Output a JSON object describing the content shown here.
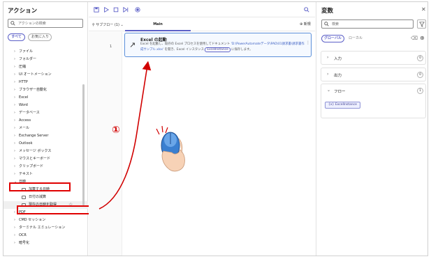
{
  "actions_panel": {
    "title": "アクション",
    "search_placeholder": "アクションの検索",
    "chip_all": "すべて",
    "chip_favorites": "お気に入り",
    "tree": [
      {
        "label": "ファイル",
        "expanded": false
      },
      {
        "label": "フォルダー",
        "expanded": false
      },
      {
        "label": "圧縮",
        "expanded": false
      },
      {
        "label": "UI オートメーション",
        "expanded": false
      },
      {
        "label": "HTTP",
        "expanded": false
      },
      {
        "label": "ブラウザー自動化",
        "expanded": false
      },
      {
        "label": "Excel",
        "expanded": false
      },
      {
        "label": "Word",
        "expanded": false
      },
      {
        "label": "データベース",
        "expanded": false
      },
      {
        "label": "Access",
        "expanded": false
      },
      {
        "label": "メール",
        "expanded": false
      },
      {
        "label": "Exchange Server",
        "expanded": false
      },
      {
        "label": "Outlook",
        "expanded": false
      },
      {
        "label": "メッセージ ボックス",
        "expanded": false
      },
      {
        "label": "マウスとキーボード",
        "expanded": false
      },
      {
        "label": "クリップボード",
        "expanded": false
      },
      {
        "label": "テキスト",
        "expanded": false
      },
      {
        "label": "日時",
        "expanded": true
      }
    ],
    "datetime_children": [
      "加算する日時",
      "日付の減算",
      "現在の日時を取得"
    ],
    "tree_after": [
      "PDF",
      "CMD セッション",
      "ターミナル エミュレーション",
      "OCR",
      "暗号化"
    ]
  },
  "designer": {
    "subflow_label": "サブフロー (1)",
    "tab_main": "Main",
    "new_label": "新規",
    "line_number": "1",
    "step": {
      "title": "Excel の起動",
      "desc_prefix": "Excel を起動し、既存の Excel プロセスを使用してドキュメント",
      "desc_path": "'D:\\PowerAutomateデータ\\PAD\\01請求書\\請求書作成サンプル.xlsx'",
      "desc_mid": "を開き、Excel インスタンス",
      "desc_var": "ExcelInstance",
      "desc_suffix": "に保存します。"
    },
    "annotation_number": "①"
  },
  "variables_panel": {
    "title": "変数",
    "search_placeholder": "検索",
    "chip_global": "グローバル",
    "chip_local": "ローカル",
    "sections": [
      {
        "label": "入力",
        "count": "0"
      },
      {
        "label": "出力",
        "count": "0"
      },
      {
        "label": "フロー",
        "count": "1"
      }
    ],
    "flow_variable": "ExcelInstance"
  },
  "colors": {
    "accent": "#5b5fc7",
    "highlight_red": "#e00000",
    "card_border": "#5b8fd9"
  }
}
